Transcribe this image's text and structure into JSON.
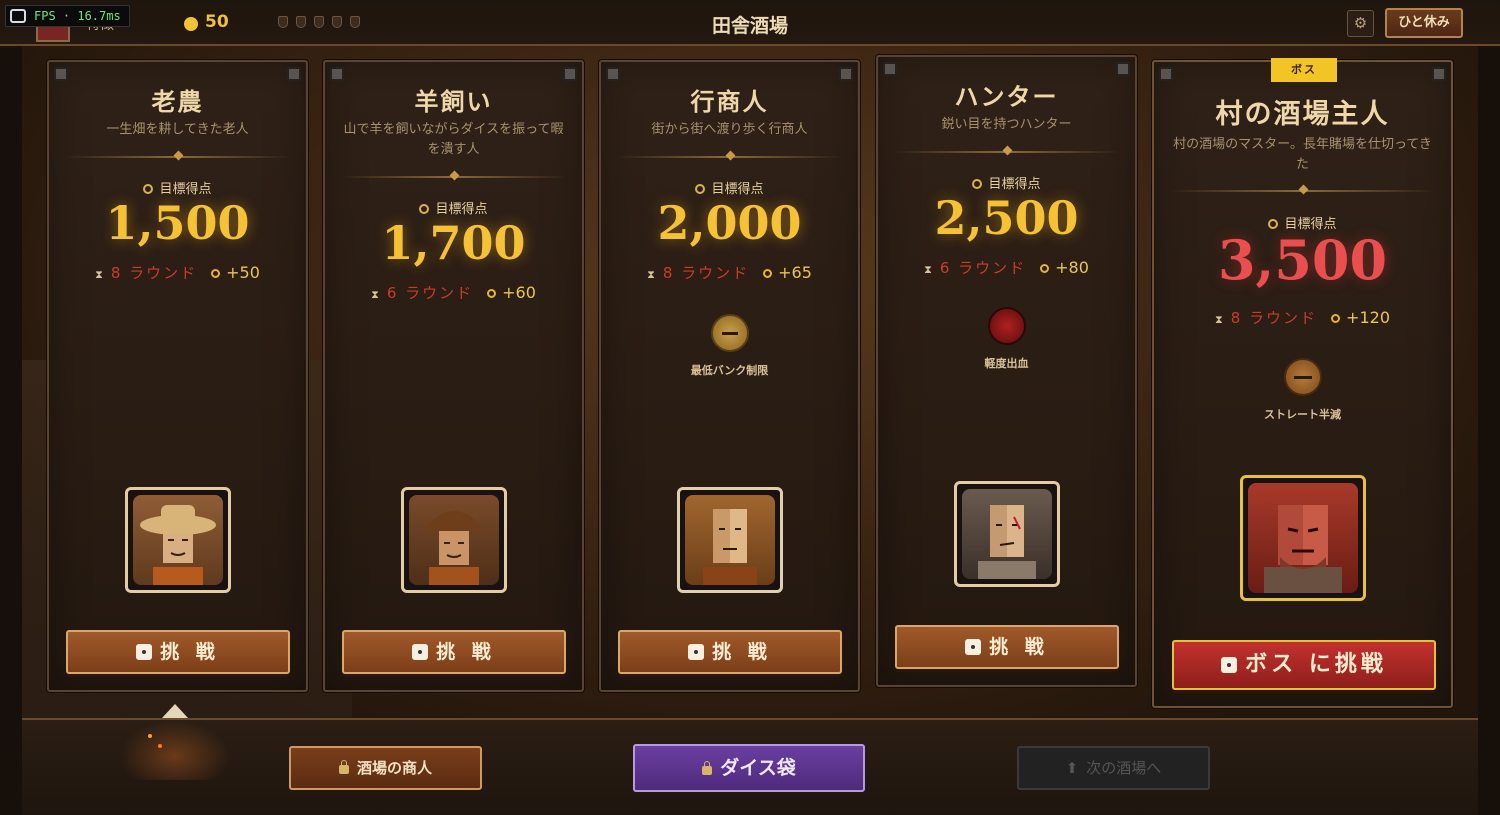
{
  "topbar": {
    "fps": "FPS · 16.7ms",
    "player_name": "特徴",
    "coins": "50",
    "title": "田舎酒場",
    "rest_button": "ひと休み"
  },
  "labels": {
    "target": "目標得点",
    "challenge": "挑 戦",
    "boss_challenge": "ボス に挑戦",
    "boss_tag": "ボス"
  },
  "opponents": [
    {
      "name": "老農",
      "desc": "一生畑を耕してきた老人",
      "target": "1,500",
      "rounds": "8 ラウンド",
      "reward": "+50",
      "modifier": ""
    },
    {
      "name": "羊飼い",
      "desc": "山で羊を飼いながらダイスを振って暇を潰す人",
      "target": "1,700",
      "rounds": "6 ラウンド",
      "reward": "+60",
      "modifier": ""
    },
    {
      "name": "行商人",
      "desc": "街から街へ渡り歩く行商人",
      "target": "2,000",
      "rounds": "8 ラウンド",
      "reward": "+65",
      "modifier": "最低バンク制限"
    },
    {
      "name": "ハンター",
      "desc": "鋭い目を持つハンター",
      "target": "2,500",
      "rounds": "6 ラウンド",
      "reward": "+80",
      "modifier": "軽度出血"
    },
    {
      "name": "村の酒場主人",
      "desc": "村の酒場のマスター。長年賭場を仕切ってきた",
      "target": "3,500",
      "rounds": "8 ラウンド",
      "reward": "+120",
      "modifier": "ストレート半減"
    }
  ],
  "bottom": {
    "merchant": "酒場の商人",
    "dice_bag": "ダイス袋",
    "next_tavern": "次の酒場へ"
  },
  "colors": {
    "gold": "#f4c234",
    "boss_red": "#ea4f4f",
    "button_brown": "#a05a2a",
    "dice_bag_purple": "#6a3fa0"
  }
}
